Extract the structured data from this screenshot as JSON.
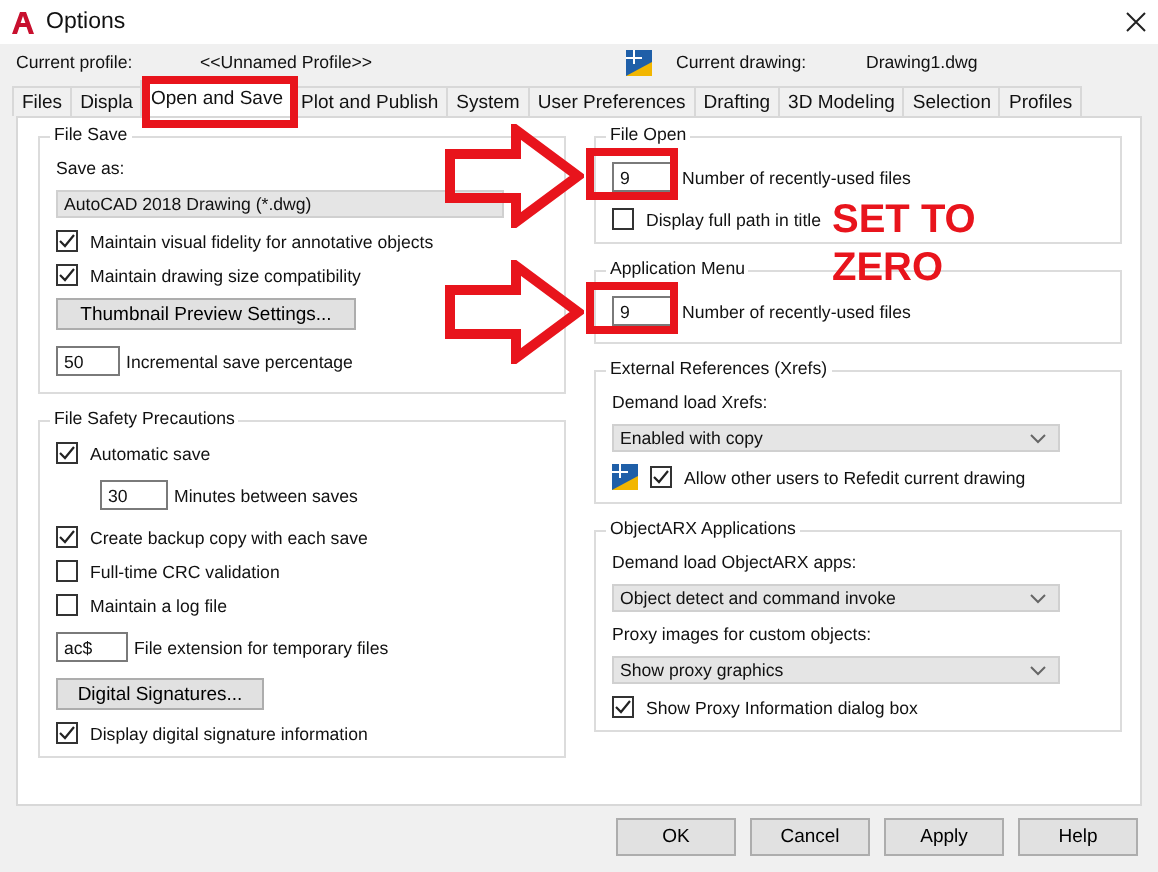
{
  "window": {
    "title": "Options"
  },
  "profile": {
    "label": "Current profile:",
    "value": "<<Unnamed Profile>>"
  },
  "drawing": {
    "label": "Current drawing:",
    "value": "Drawing1.dwg"
  },
  "tabs": [
    {
      "label": "Files",
      "selected": false
    },
    {
      "label": "Displa",
      "selected": false
    },
    {
      "label": "Open and Save",
      "selected": true
    },
    {
      "label": "Plot and Publish",
      "selected": false
    },
    {
      "label": "System",
      "selected": false
    },
    {
      "label": "User Preferences",
      "selected": false
    },
    {
      "label": "Drafting",
      "selected": false
    },
    {
      "label": "3D Modeling",
      "selected": false
    },
    {
      "label": "Selection",
      "selected": false
    },
    {
      "label": "Profiles",
      "selected": false
    }
  ],
  "left_groups": [
    {
      "title": "File Save",
      "items": [
        {
          "kind": "label",
          "text": "Save as:"
        },
        {
          "kind": "dropdown",
          "value": "AutoCAD 2018 Drawing (*.dwg)",
          "arrow": false
        },
        {
          "kind": "checkbox",
          "label": "Maintain visual fidelity for annotative objects",
          "checked": true
        },
        {
          "kind": "checkbox",
          "label": "Maintain drawing size compatibility",
          "checked": true
        },
        {
          "kind": "button",
          "label": "Thumbnail Preview Settings..."
        },
        {
          "kind": "field",
          "value": "50",
          "label": "Incremental save percentage"
        }
      ]
    },
    {
      "title": "File Safety Precautions",
      "items": [
        {
          "kind": "checkbox",
          "label": "Automatic save",
          "checked": true
        },
        {
          "kind": "indented_field",
          "value": "30",
          "label": "Minutes between saves"
        },
        {
          "kind": "checkbox",
          "label": "Create backup copy with each save",
          "checked": true
        },
        {
          "kind": "checkbox",
          "label": "Full-time CRC validation",
          "checked": false
        },
        {
          "kind": "checkbox",
          "label": "Maintain a log file",
          "checked": false
        },
        {
          "kind": "field",
          "value": "ac$",
          "label": "File extension for temporary files"
        },
        {
          "kind": "button",
          "label": "Digital Signatures..."
        },
        {
          "kind": "checkbox",
          "label": "Display digital signature information",
          "checked": true
        }
      ]
    }
  ],
  "right_groups": [
    {
      "title": "File Open",
      "items": [
        {
          "kind": "field",
          "value": "9",
          "label": "Number of recently-used files"
        },
        {
          "kind": "checkbox",
          "label": "Display full path in title",
          "checked": false
        }
      ]
    },
    {
      "title": "Application Menu",
      "items": [
        {
          "kind": "field",
          "value": "9",
          "label": "Number of recently-used files"
        }
      ]
    },
    {
      "title": "External References (Xrefs)",
      "items": [
        {
          "kind": "label",
          "text": "Demand load Xrefs:"
        },
        {
          "kind": "dropdown",
          "value": "Enabled with copy",
          "arrow": true
        },
        {
          "kind": "icon_checkbox",
          "label": "Allow other users to Refedit current drawing",
          "checked": true
        }
      ]
    },
    {
      "title": "ObjectARX Applications",
      "items": [
        {
          "kind": "label",
          "text": "Demand load ObjectARX apps:"
        },
        {
          "kind": "dropdown",
          "value": "Object detect and command invoke",
          "arrow": true
        },
        {
          "kind": "label",
          "text": "Proxy images for custom objects:"
        },
        {
          "kind": "dropdown",
          "value": "Show proxy graphics",
          "arrow": true
        },
        {
          "kind": "checkbox",
          "label": "Show Proxy Information dialog box",
          "checked": true
        }
      ]
    }
  ],
  "buttons": [
    "OK",
    "Cancel",
    "Apply",
    "Help"
  ],
  "annotation": {
    "text": "SET TO ZERO"
  }
}
